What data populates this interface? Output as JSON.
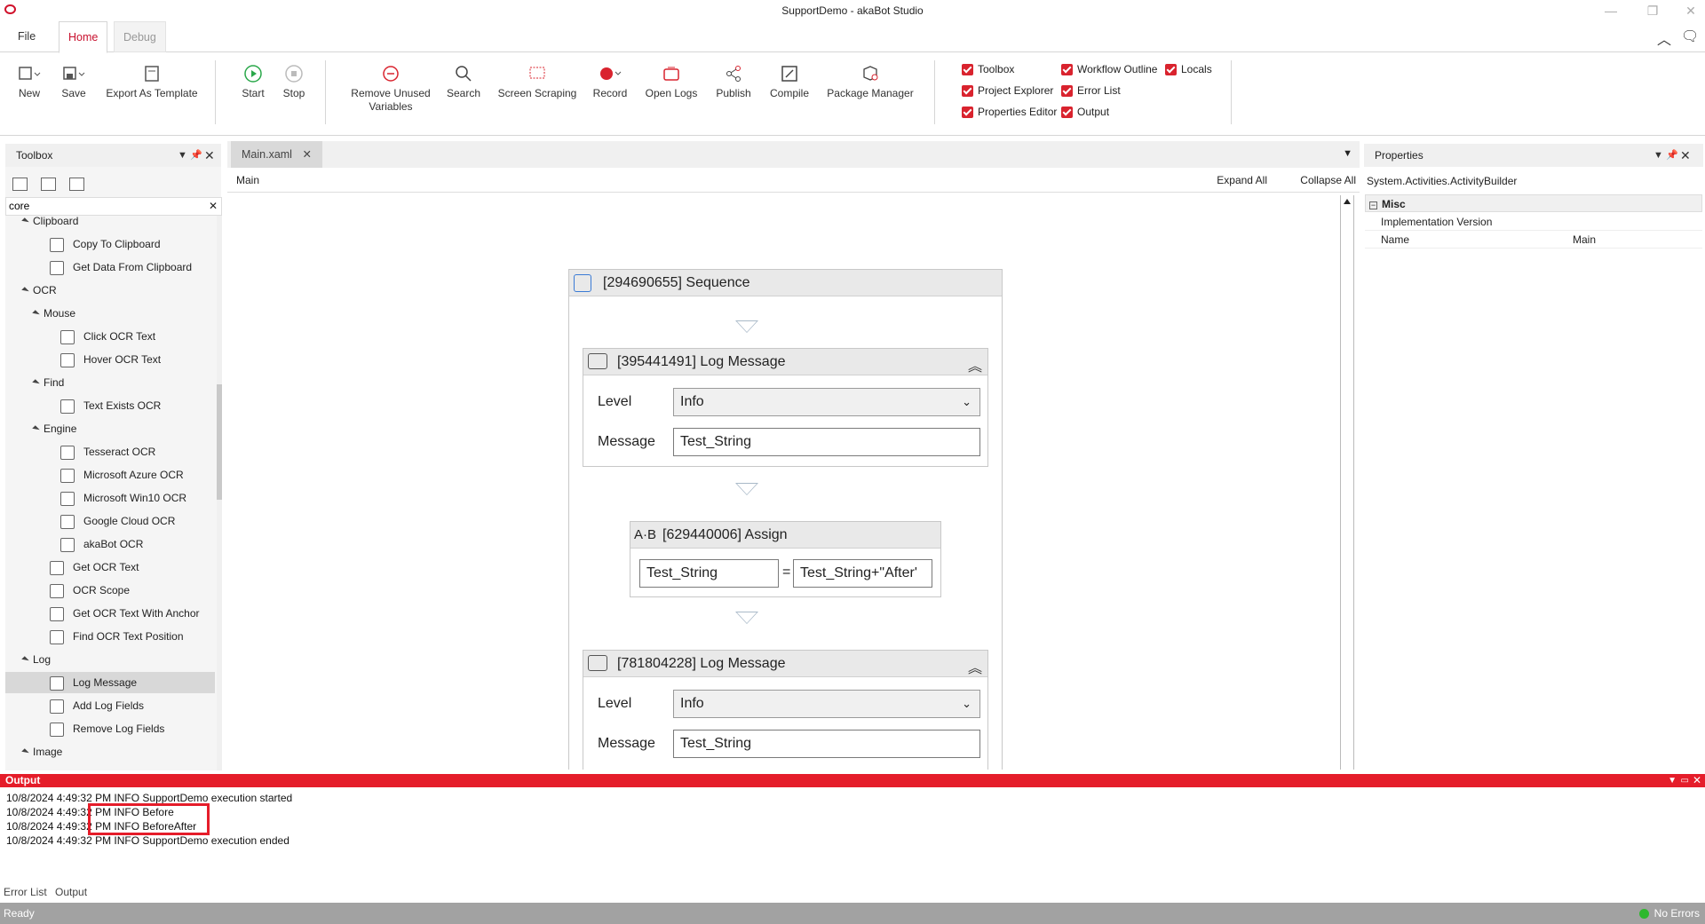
{
  "window": {
    "title": "SupportDemo - akaBot Studio"
  },
  "ribbon_tabs": [
    "File",
    "Home",
    "Debug"
  ],
  "ribbon": {
    "new": "New",
    "save": "Save",
    "export_template": "Export As Template",
    "start": "Start",
    "stop": "Stop",
    "remove_unused_1": "Remove Unused",
    "remove_unused_2": "Variables",
    "search": "Search",
    "screen_scraping": "Screen Scraping",
    "record": "Record",
    "open_logs": "Open Logs",
    "publish": "Publish",
    "compile": "Compile",
    "package_manager": "Package Manager"
  },
  "panels_toggles": {
    "toolbox": "Toolbox",
    "project_explorer": "Project Explorer",
    "properties_editor": "Properties Editor",
    "workflow_outline": "Workflow Outline",
    "error_list": "Error List",
    "output": "Output",
    "locals": "Locals"
  },
  "toolbox": {
    "title": "Toolbox",
    "search_value": "core",
    "items": [
      {
        "label": "Clipboard",
        "kind": "group"
      },
      {
        "label": "Copy To Clipboard",
        "kind": "item"
      },
      {
        "label": "Get Data From Clipboard",
        "kind": "item"
      },
      {
        "label": "OCR",
        "kind": "group"
      },
      {
        "label": "Mouse",
        "kind": "group"
      },
      {
        "label": "Click OCR Text",
        "kind": "item"
      },
      {
        "label": "Hover OCR Text",
        "kind": "item"
      },
      {
        "label": "Find",
        "kind": "group"
      },
      {
        "label": "Text Exists OCR",
        "kind": "item"
      },
      {
        "label": "Engine",
        "kind": "group"
      },
      {
        "label": "Tesseract OCR",
        "kind": "item"
      },
      {
        "label": "Microsoft Azure OCR",
        "kind": "item"
      },
      {
        "label": "Microsoft Win10 OCR",
        "kind": "item"
      },
      {
        "label": "Google Cloud OCR",
        "kind": "item"
      },
      {
        "label": "akaBot OCR",
        "kind": "item"
      },
      {
        "label": "Get OCR Text",
        "kind": "item"
      },
      {
        "label": "OCR Scope",
        "kind": "item"
      },
      {
        "label": "Get OCR Text With Anchor",
        "kind": "item"
      },
      {
        "label": "Find OCR Text Position",
        "kind": "item"
      },
      {
        "label": "Log",
        "kind": "group"
      },
      {
        "label": "Log Message",
        "kind": "item",
        "selected": true
      },
      {
        "label": "Add Log Fields",
        "kind": "item"
      },
      {
        "label": "Remove Log Fields",
        "kind": "item"
      },
      {
        "label": "Image",
        "kind": "group"
      }
    ]
  },
  "designer": {
    "tab": "Main.xaml",
    "breadcrumb": "Main",
    "expand_all": "Expand All",
    "collapse_all": "Collapse All",
    "sequence_title": "[294690655] Sequence",
    "log1": {
      "title": "[395441491] Log Message",
      "level_label": "Level",
      "level_value": "Info",
      "message_label": "Message",
      "message_value": "Test_String"
    },
    "assign": {
      "title": "[629440006] Assign",
      "to": "Test_String",
      "eq": "=",
      "value": "Test_String+\"After'"
    },
    "log2": {
      "title": "[781804228] Log Message",
      "level_label": "Level",
      "level_value": "Info",
      "message_label": "Message",
      "message_value": "Test_String"
    }
  },
  "properties": {
    "title": "Properties",
    "object": "System.Activities.ActivityBuilder",
    "category": "Misc",
    "rows": [
      {
        "name": "Implementation Version",
        "value": ""
      },
      {
        "name": "Name",
        "value": "Main"
      }
    ]
  },
  "output": {
    "title": "Output",
    "lines": [
      "10/8/2024 4:49:32 PM INFO SupportDemo execution started",
      "10/8/2024 4:49:32 PM INFO Before",
      "10/8/2024 4:49:32 PM INFO BeforeAfter",
      "10/8/2024 4:49:32 PM INFO SupportDemo execution ended"
    ]
  },
  "bottom_tabs": [
    "Error List",
    "Output"
  ],
  "status": {
    "left": "Ready",
    "right": "No Errors"
  },
  "colors": {
    "accent": "#e51d2a",
    "status_ok": "#2db82d"
  }
}
